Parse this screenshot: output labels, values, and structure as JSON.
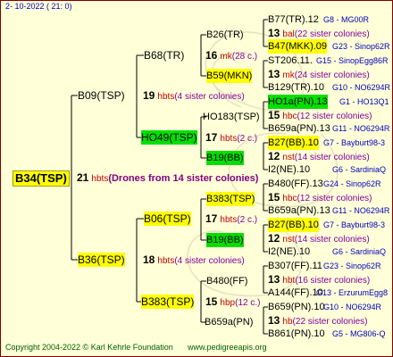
{
  "header": {
    "date": "2- 10-2022 ( 21:  0)"
  },
  "root": {
    "id": "B34(TSP)",
    "count": "21",
    "unit": "hbts",
    "note": "(Drones from 14 sister colonies)"
  },
  "gen1": [
    {
      "id": "B09(TSP)",
      "count": "19",
      "unit": "hbts",
      "note": "(4 sister colonies)"
    },
    {
      "id": "B36(TSP)",
      "count": "18",
      "unit": "hbts",
      "note": "(4 sister colonies)"
    }
  ],
  "gen2": [
    {
      "id": "B68(TR)",
      "count": "16",
      "unit": "mk",
      "note": "(28 c.)"
    },
    {
      "id": "HO49(TSP)",
      "count": "17",
      "unit": "hbts",
      "note": "(2 c.)"
    },
    {
      "id": "B06(TSP)",
      "count": "17",
      "unit": "hbts",
      "note": "(2 c.)"
    },
    {
      "id": "B383(TSP)",
      "count": "15",
      "unit": "hbp",
      "note": "(12 c.)"
    }
  ],
  "gen3": [
    {
      "id": "B26(TR)"
    },
    {
      "id": "B59(MKN)"
    },
    {
      "id": "HO183(TSP)"
    },
    {
      "id": "B19(BB)"
    },
    {
      "id": "B383(TSP)"
    },
    {
      "id": "B19(BB)"
    },
    {
      "id": "B480(FF)"
    },
    {
      "id": "B659a(PN)"
    }
  ],
  "gen4": [
    {
      "id": "B77(TR).12",
      "code": "G8 - MG00R",
      "count": "13",
      "unit": "bal",
      "note": "(22 sister colonies)",
      "id2": "B47(MKK).09",
      "code2": "G23 - Sinop62R"
    },
    {
      "id": "ST206.11.",
      "code": "G15 - SinopEgg86R",
      "count": "13",
      "unit": "mk",
      "note": "(24 sister colonies)",
      "id2": "B129(TR).10",
      "code2": "G10 - NO6294R"
    },
    {
      "id": "HO1a(PN).13",
      "code": "G1 - HO13Q1",
      "count": "15",
      "unit": "hbc",
      "note": "(12 sister colonies)",
      "id2": "B659a(PN).13",
      "code2": "G11 - NO6294R"
    },
    {
      "id": "B27(BB).10",
      "code": "G7 - Bayburt98-3",
      "count": "12",
      "unit": "nst",
      "note": "(14 sister colonies)",
      "id2": "I2(NE).10",
      "code2": "G6 - SardiniaQ"
    },
    {
      "id": "B480(FF).13",
      "code": "G24 - Sinop62R",
      "count": "15",
      "unit": "hbc",
      "note": "(12 sister colonies)",
      "id2": "B659a(PN).13",
      "code2": "G11 - NO6294R"
    },
    {
      "id": "B27(BB).10",
      "code": "G7 - Bayburt98-3",
      "count": "12",
      "unit": "nst",
      "note": "(14 sister colonies)",
      "id2": "I2(NE).10",
      "code2": "G6 - SardiniaQ"
    },
    {
      "id": "B307(FF).11",
      "code": "G23 - Sinop62R",
      "count": "13",
      "unit": "hbt",
      "note": "(16 sister colonies)",
      "id2": "A144(FF).10",
      "code2": "G13 - ErzurumEgg8"
    },
    {
      "id": "B659(PN).10",
      "code": "G10 - NO6294R",
      "count": "13",
      "unit": "hb",
      "note": "(22 sister colonies)",
      "id2": "B861(PN).10",
      "code2": "G5 - MG806-Q"
    }
  ],
  "footer": {
    "copyright": "Copyright 2004-2022 © Karl Kehrle Foundation",
    "url": "www.pedigreeapis.org"
  }
}
